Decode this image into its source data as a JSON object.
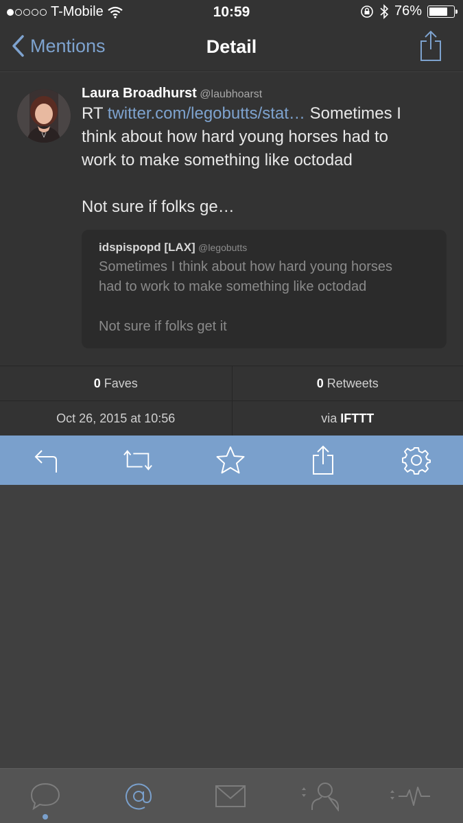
{
  "status_bar": {
    "carrier": "T-Mobile",
    "signal_bars_filled": 1,
    "signal_bars_total": 5,
    "time": "10:59",
    "battery_percent": "76%",
    "battery_level": 0.76
  },
  "nav": {
    "back_label": "Mentions",
    "title": "Detail"
  },
  "tweet": {
    "author_name": "Laura Broadhurst",
    "author_handle": "@laubhoarst",
    "text_prefix": "RT ",
    "link": "twitter.com/legobutts/stat…",
    "text_line1": " Sometimes I",
    "text_line2": "think about how hard young horses had to",
    "text_line3": "work to make something like octodad",
    "text_line4": "Not sure if folks ge…",
    "quote": {
      "name": "idspispopd [LAX]",
      "handle": "@legobutts",
      "line1": "Sometimes I think about how hard young horses",
      "line2": "had to work to make something like octodad",
      "line3": "Not sure if folks get it"
    }
  },
  "stats": {
    "faves_count": "0",
    "faves_label": " Faves",
    "retweets_count": "0",
    "retweets_label": " Retweets",
    "timestamp": "Oct 26, 2015 at 10:56",
    "via_label": "via ",
    "via_app": "IFTTT"
  },
  "actions": [
    "reply-icon",
    "retweet-icon",
    "star-icon",
    "share-icon",
    "gear-icon"
  ],
  "tabs": [
    "chat-bubble-icon",
    "at-mention-icon",
    "mail-icon",
    "profile-icon",
    "activity-icon"
  ],
  "colors": {
    "accent": "#7aa0cc",
    "link": "#7ea3cf",
    "background": "#404040",
    "panel": "#333333"
  }
}
